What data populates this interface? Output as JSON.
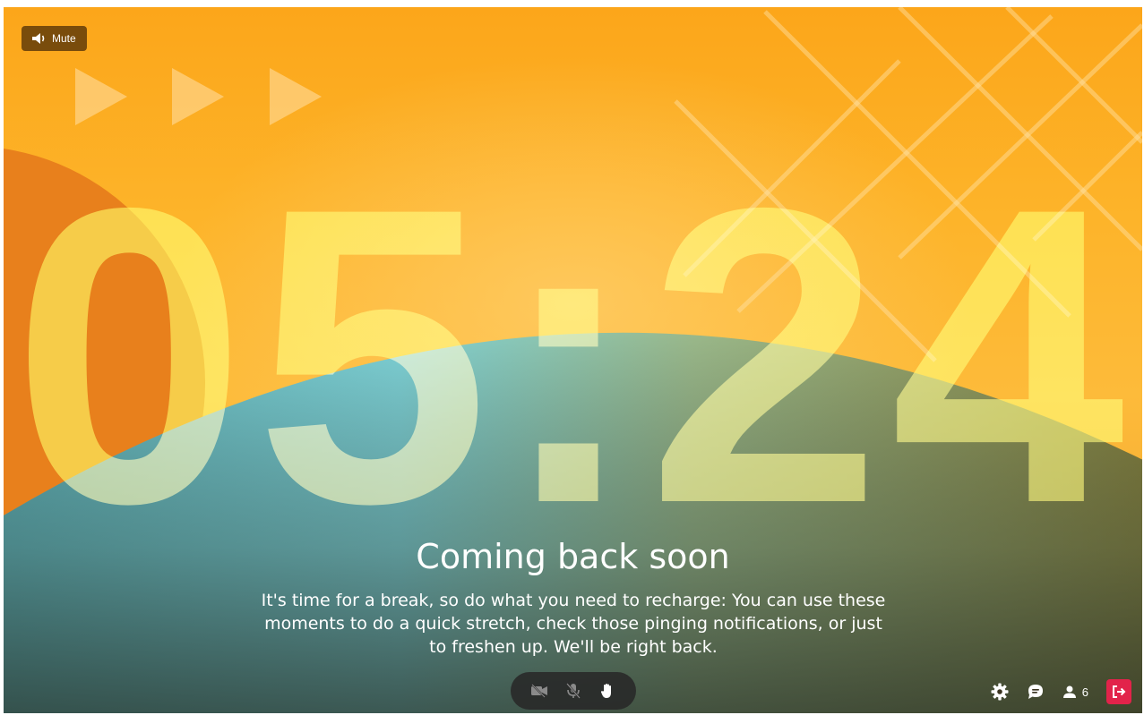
{
  "screen": {
    "mute_button": {
      "label": "Mute",
      "icon": "speaker-icon"
    },
    "countdown": {
      "minutes": "05",
      "separator": ":",
      "seconds": "24"
    },
    "headline": "Coming back soon",
    "message": "It's time for a break, so do what you need to recharge: You can use these moments to do a quick stretch, check those pinging notifications, or just to freshen up. We'll be right back."
  },
  "controls": {
    "camera": {
      "icon": "camera-off-icon",
      "state": "off"
    },
    "microphone": {
      "icon": "mic-off-icon",
      "state": "off"
    },
    "raise_hand": {
      "icon": "raise-hand-icon"
    }
  },
  "right_bar": {
    "settings": {
      "icon": "gear-icon"
    },
    "chat": {
      "icon": "chat-icon"
    },
    "participants": {
      "icon": "person-icon",
      "count": "6"
    },
    "leave": {
      "icon": "leave-icon",
      "color": "#e2234a"
    }
  },
  "colors": {
    "background_top": "#fca61a",
    "background_mid": "#fdbb3a",
    "hill_teal": "#74c8cf",
    "hill_olive": "#7b7a3a",
    "timer_yellow": "#fff550",
    "accent_red": "#e2234a"
  }
}
